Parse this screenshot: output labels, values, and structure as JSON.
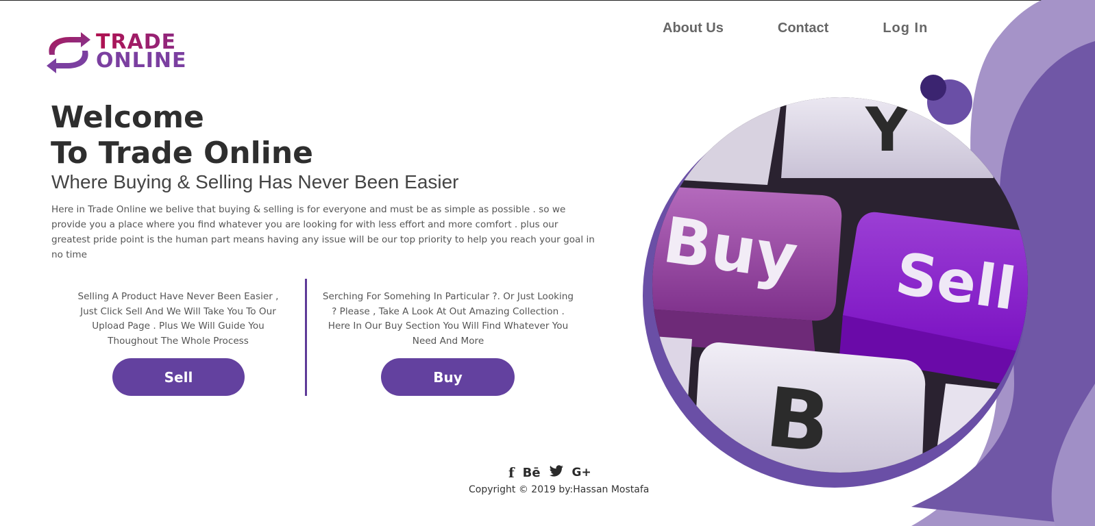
{
  "brand": {
    "logo_line1": "TRADE",
    "logo_line2": "ONLINE"
  },
  "nav": {
    "about": "About Us",
    "contact": "Contact",
    "login": "Log In"
  },
  "hero": {
    "title_line1": "Welcome",
    "title_line2": "To Trade Online",
    "subtitle": "Where Buying & Selling Has Never Been Easier",
    "description": "Here in Trade Online we belive that buying & selling is for everyone and must be as simple as possible . so we provide you a place where you find whatever you are looking for with less effort and more comfort . plus our greatest pride point is the human part means having any issue will be our top priority to help you reach your goal in no time"
  },
  "sell": {
    "text": "Selling A Product Have Never Been Easier , Just Click Sell And We Will Take You To Our Upload Page . Plus We Will Guide You Thoughout The Whole Process",
    "button": "Sell"
  },
  "buy": {
    "text": "Serching For Somehing In Particular ?. Or Just Looking ? Please , Take A Look At Out Amazing Collection . Here In Our Buy Section You Will Find Whatever You Need And More",
    "button": "Buy"
  },
  "keyboard": {
    "key_y": "Y",
    "key_buy": "Buy",
    "key_sell": "Sell",
    "key_b": "B"
  },
  "footer": {
    "social": {
      "facebook": "f",
      "behance": "Bē",
      "google_plus": "G+"
    },
    "copyright": "Copyright © 2019 by:Hassan Mostafa"
  },
  "colors": {
    "accent": "#63419f",
    "brand_pink": "#b0114f",
    "brand_purple": "#7b3fa0"
  }
}
